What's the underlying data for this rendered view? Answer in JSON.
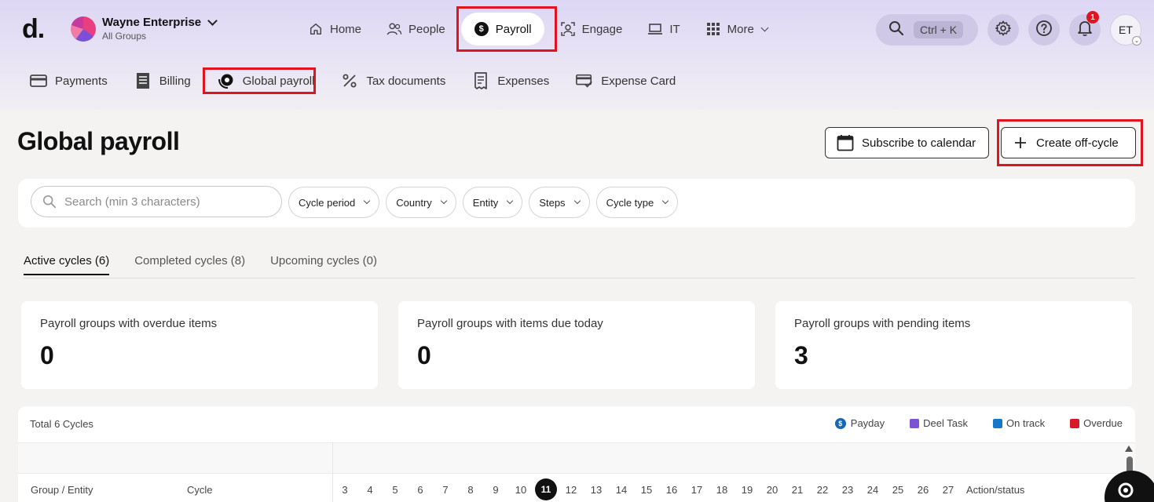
{
  "brand": {
    "logo": "d."
  },
  "org": {
    "name": "Wayne Enterprise",
    "sub": "All Groups"
  },
  "main_nav": [
    {
      "label": "Home",
      "icon": "home-icon"
    },
    {
      "label": "People",
      "icon": "people-icon"
    },
    {
      "label": "Payroll",
      "icon": "dollar-icon",
      "active": true
    },
    {
      "label": "Engage",
      "icon": "engage-icon"
    },
    {
      "label": "IT",
      "icon": "laptop-icon"
    },
    {
      "label": "More",
      "icon": "grid-icon"
    }
  ],
  "search": {
    "shortcut": "Ctrl + K"
  },
  "notifications": {
    "count": "1"
  },
  "user": {
    "initials": "ET"
  },
  "sub_nav": [
    {
      "label": "Payments",
      "icon": "card-icon"
    },
    {
      "label": "Billing",
      "icon": "billing-icon"
    },
    {
      "label": "Global payroll",
      "icon": "global-payroll-icon",
      "active": true
    },
    {
      "label": "Tax documents",
      "icon": "percent-icon"
    },
    {
      "label": "Expenses",
      "icon": "receipt-icon"
    },
    {
      "label": "Expense Card",
      "icon": "expense-card-icon"
    }
  ],
  "page": {
    "title": "Global payroll",
    "subscribe_label": "Subscribe to calendar",
    "create_label": "Create off-cycle"
  },
  "filters": {
    "search_placeholder": "Search (min 3 characters)",
    "chips": [
      "Cycle period",
      "Country",
      "Entity",
      "Steps",
      "Cycle type"
    ]
  },
  "tabs": [
    "Active cycles (6)",
    "Completed cycles (8)",
    "Upcoming cycles (0)"
  ],
  "cards": [
    {
      "label": "Payroll groups with overdue items",
      "value": "0"
    },
    {
      "label": "Payroll groups with items due today",
      "value": "0"
    },
    {
      "label": "Payroll groups with pending items",
      "value": "3"
    }
  ],
  "calendar": {
    "total": "Total 6 Cycles",
    "legend": [
      {
        "label": "Payday",
        "color": "#1667b8"
      },
      {
        "label": "Deel Task",
        "color": "#7b52d6"
      },
      {
        "label": "On track",
        "color": "#1676c8"
      },
      {
        "label": "Overdue",
        "color": "#d8192a"
      }
    ],
    "columns": {
      "group": "Group / Entity",
      "cycle": "Cycle",
      "action": "Action/status"
    },
    "days": [
      "3",
      "4",
      "5",
      "6",
      "7",
      "8",
      "9",
      "10",
      "11",
      "12",
      "13",
      "14",
      "15",
      "16",
      "17",
      "18",
      "19",
      "20",
      "21",
      "22",
      "23",
      "24",
      "25",
      "26",
      "27"
    ],
    "today": "11"
  }
}
